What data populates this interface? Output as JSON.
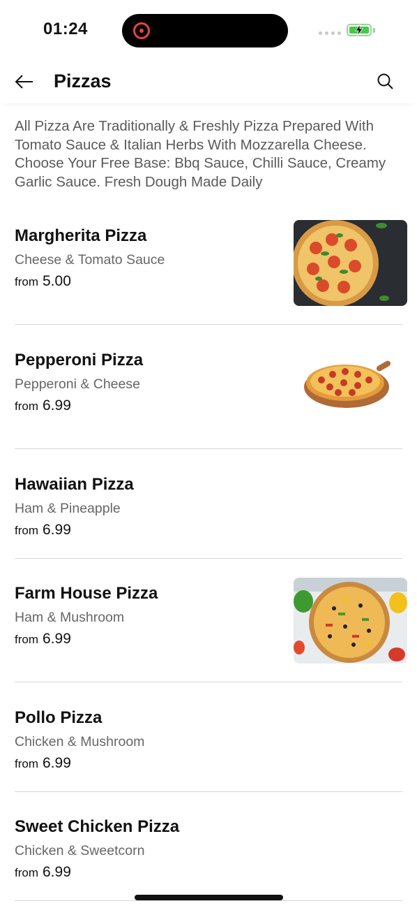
{
  "status_bar": {
    "time": "01:24"
  },
  "header": {
    "title": "Pizzas",
    "back_icon": "arrow-left-icon",
    "search_icon": "search-icon"
  },
  "description": "All Pizza Are Traditionally & Freshly Pizza Prepared With Tomato Sauce & Italian Herbs With Mozzarella Cheese. Choose Your Free Base: Bbq Sauce, Chilli Sauce, Creamy Garlic Sauce.  Fresh Dough Made Daily",
  "items": [
    {
      "name": "Margherita Pizza",
      "desc": "Cheese & Tomato Sauce",
      "from": "from",
      "price": "5.00",
      "has_image": true
    },
    {
      "name": "Pepperoni Pizza",
      "desc": "Pepperoni & Cheese",
      "from": "from",
      "price": "6.99",
      "has_image": true
    },
    {
      "name": "Hawaiian Pizza",
      "desc": "Ham & Pineapple",
      "from": "from",
      "price": "6.99",
      "has_image": false
    },
    {
      "name": "Farm House Pizza",
      "desc": "Ham & Mushroom",
      "from": "from",
      "price": "6.99",
      "has_image": true
    },
    {
      "name": "Pollo Pizza",
      "desc": "Chicken & Mushroom",
      "from": "from",
      "price": "6.99",
      "has_image": false
    },
    {
      "name": "Sweet Chicken Pizza",
      "desc": "Chicken & Sweetcorn",
      "from": "from",
      "price": "6.99",
      "has_image": false
    }
  ],
  "colors": {
    "recording": "#e8463b",
    "battery": "#46c94a",
    "text_primary": "#111111",
    "text_secondary": "#666666",
    "divider": "#d6d6d6"
  }
}
